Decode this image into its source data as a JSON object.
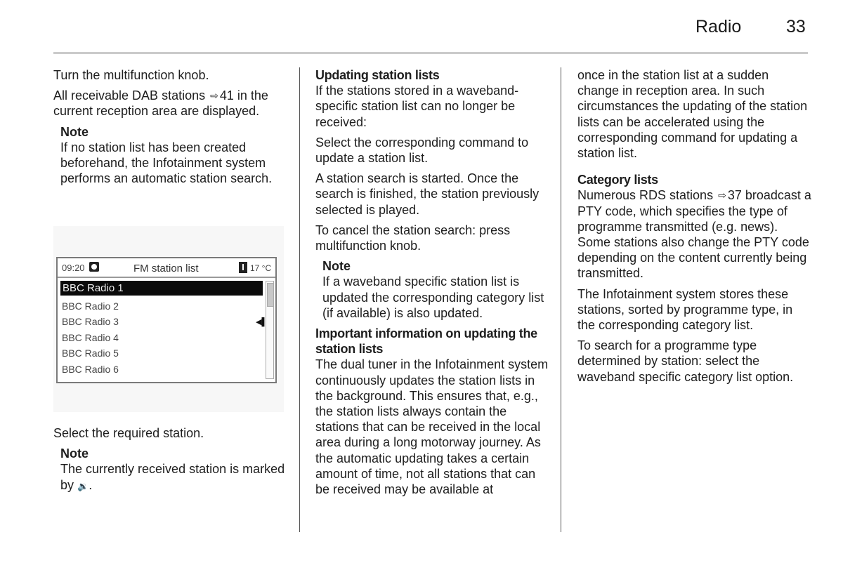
{
  "header": {
    "section_title": "Radio",
    "page_number": "33"
  },
  "icons": {
    "arrow": "⇨",
    "speaker": "🔉"
  },
  "column1": {
    "p1": "Turn the multifunction knob.",
    "p2_before": "All receivable DAB stations",
    "p2_ref": "41",
    "p2_after": " in the current reception area are displayed.",
    "note1_title": "Note",
    "note1_text": "If no station list has been created beforehand, the Infotainment system performs an automatic station search.",
    "p3": "Select the required station.",
    "note2_title": "Note",
    "note2_text": "The currently received station is marked by",
    "note2_end": "."
  },
  "screen": {
    "time": "09:20",
    "title": "FM station list",
    "temperature": "17 °C",
    "selected_station": "BBC Radio 1",
    "stations": [
      "BBC Radio 2",
      "BBC Radio 3",
      "BBC Radio 4",
      "BBC Radio 5",
      "BBC Radio 6"
    ],
    "playing_station": "BBC Radio 3",
    "scroll_position_fraction": 0.0
  },
  "column2": {
    "h1": "Updating station lists",
    "p1": "If the stations stored in a waveband-specific station list can no longer be received:",
    "p2": "Select the corresponding command to update a station list.",
    "p3": "A station search is started. Once the search is finished, the station previously selected is played.",
    "p4": "To cancel the station search: press multifunction knob.",
    "note_title": "Note",
    "note_text": "If a waveband specific station list is updated the corresponding category list (if available) is also updated.",
    "h2": "Important information on updating the station lists",
    "p5": "The dual tuner in the Infotainment system continuously updates the station lists in the background. This ensures that, e.g., the station lists always contain the stations that can be received in the local area during a long motorway journey. As the automatic updating takes a certain amount of time, not all stations that can be received may be available at"
  },
  "column3": {
    "p1": "once in the station list at a sudden change in reception area. In such circumstances the updating of the station lists can be accelerated using the corresponding command for updating a station list.",
    "h1": "Category lists",
    "p2_before": "Numerous RDS stations",
    "p2_ref": "37",
    "p2_after": " broadcast a PTY code, which specifies the type of programme transmitted (e.g. news). Some stations also change the PTY code depending on the content currently being transmitted.",
    "p3": "The Infotainment system stores these stations, sorted by programme type, in the corresponding category list.",
    "p4": "To search for a programme type determined by station: select the waveband specific category list option."
  }
}
